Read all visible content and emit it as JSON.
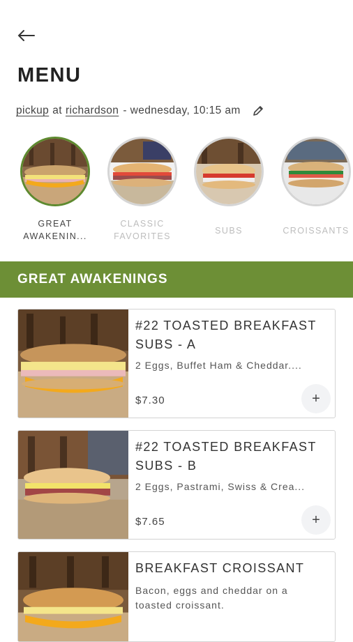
{
  "header": {
    "title": "MENU"
  },
  "context": {
    "mode": "pickup",
    "at": "at",
    "location": "richardson",
    "time": "- wednesday, 10:15 am"
  },
  "categories": [
    {
      "label": "GREAT AWAKENIN...",
      "icon": "breakfast-sub-image"
    },
    {
      "label": "CLASSIC FAVORITES",
      "icon": "classic-sub-image"
    },
    {
      "label": "SUBS",
      "icon": "sub-image"
    },
    {
      "label": "CROISSANTS",
      "icon": "croissant-image"
    }
  ],
  "section": {
    "title": "GREAT AWAKENINGS",
    "color": "#6d8f36"
  },
  "items": [
    {
      "name": "#22 TOASTED BREAKFAST SUBS - A",
      "description": "2 Eggs, Buffet Ham & Cheddar....",
      "price": "$7.30",
      "add": "+"
    },
    {
      "name": "#22 TOASTED BREAKFAST SUBS - B",
      "description": "2 Eggs, Pastrami, Swiss & Crea...",
      "price": "$7.65",
      "add": "+"
    },
    {
      "name": "BREAKFAST CROISSANT",
      "description": "Bacon, eggs and cheddar on a toasted croissant.",
      "price": "",
      "add": "+"
    }
  ],
  "colors": {
    "accent": "#6d8f36",
    "active_ring": "#5e8a2f"
  }
}
